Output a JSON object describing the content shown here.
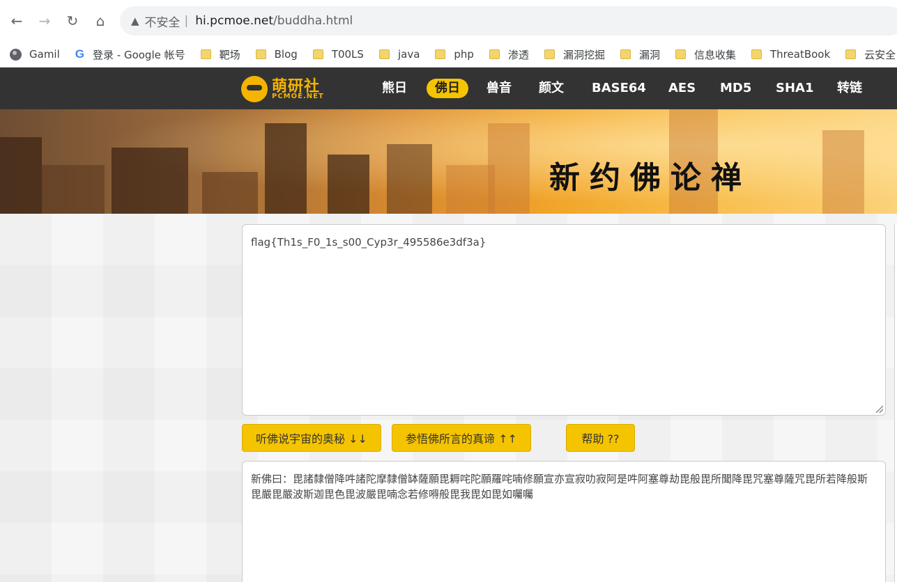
{
  "browser": {
    "url_warning": "不安全",
    "url_host": "hi.pcmoe.net",
    "url_path": "/buddha.html"
  },
  "bookmarks": [
    {
      "label": "Gamil",
      "icon": "globe-icon"
    },
    {
      "label": "登录 - Google 帐号",
      "icon": "google-icon"
    },
    {
      "label": "靶场",
      "icon": "folder-icon"
    },
    {
      "label": "Blog",
      "icon": "folder-icon"
    },
    {
      "label": "T00LS",
      "icon": "folder-icon"
    },
    {
      "label": "java",
      "icon": "folder-icon"
    },
    {
      "label": "php",
      "icon": "folder-icon"
    },
    {
      "label": "渗透",
      "icon": "folder-icon"
    },
    {
      "label": "漏洞挖掘",
      "icon": "folder-icon"
    },
    {
      "label": "漏洞",
      "icon": "folder-icon"
    },
    {
      "label": "信息收集",
      "icon": "folder-icon"
    },
    {
      "label": "ThreatBook",
      "icon": "folder-icon"
    },
    {
      "label": "云安全",
      "icon": "folder-icon"
    }
  ],
  "site": {
    "logo_cn": "萌研社",
    "logo_en": "PCMOE.NET",
    "nav": [
      "熊日",
      "佛日",
      "兽音",
      "颜文",
      "BASE64",
      "AES",
      "MD5",
      "SHA1",
      "转链"
    ],
    "active_nav": "佛日",
    "banner_title": "新约佛论禅",
    "accent_color": "#f5c400",
    "nav_bg": "#333333"
  },
  "tool": {
    "input_text": "flag{Th1s_F0_1s_s00_Cyp3r_495586e3df3a}",
    "encode_button": "听佛说宇宙的奥秘 ↓↓",
    "decode_button": "参悟佛所言的真谛 ↑↑",
    "help_button": "帮助 ??",
    "output_text": "新佛曰：毘諸隸僧降吽諸陀摩隸僧缽薩願毘耨咤陀願羅咤喃修願宣亦宣寂叻寂阿是吽阿塞尊劫毘般毘所聞降毘咒塞尊薩咒毘所若降般斯毘嚴毘嚴波斯迦毘色毘波嚴毘喃念若修嘚般毘我毘如毘如囑囑"
  }
}
